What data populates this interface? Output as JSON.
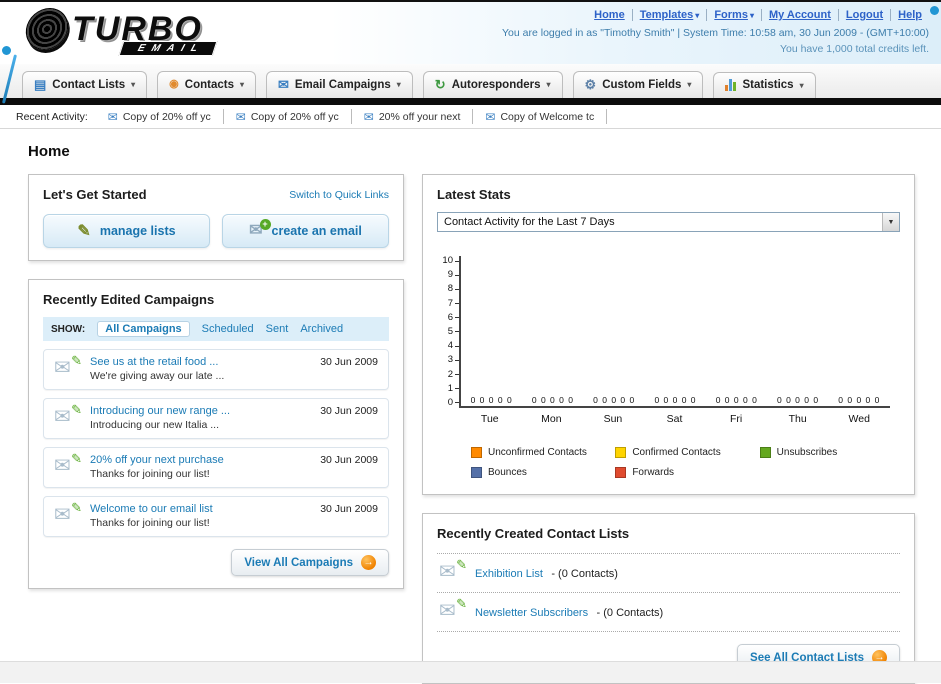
{
  "brand": {
    "name": "TURBO",
    "sub": "EMAIL"
  },
  "icons": {
    "chevron_down": "▾",
    "select_arrow": "▼",
    "envelope": "✉",
    "pencil": "✎",
    "arrow_right": "→",
    "plus": "+",
    "person": "◉",
    "list": "▤",
    "refresh": "↻",
    "gear": "⚙"
  },
  "colors": {
    "link_blue": "#1b7bb5",
    "top_link_blue": "#2d62c8",
    "nav_bar_black": "#0c0c0c",
    "orange_accent": "#f08200"
  },
  "top_nav": {
    "links": [
      "Home",
      "Templates",
      "Forms",
      "My Account",
      "Logout",
      "Help"
    ],
    "login_info": "You are logged in as \"Timothy Smith\" | System Time: 10:58 am, 30 Jun 2009 - (GMT+10:00)",
    "credits_info": "You have 1,000 total credits left."
  },
  "main_nav": {
    "items": [
      "Contact Lists",
      "Contacts",
      "Email Campaigns",
      "Autoresponders",
      "Custom Fields",
      "Statistics"
    ]
  },
  "recent_activity": {
    "label": "Recent Activity:",
    "items": [
      "Copy of 20% off yc",
      "Copy of 20% off yc",
      "20% off your next",
      "Copy of Welcome tc"
    ]
  },
  "page": {
    "title": "Home"
  },
  "get_started": {
    "title": "Let's Get Started",
    "switch_link": "Switch to Quick Links",
    "buttons": [
      {
        "label": "manage lists"
      },
      {
        "label": "create an email"
      }
    ]
  },
  "campaigns": {
    "title": "Recently Edited Campaigns",
    "show_label": "SHOW:",
    "tabs": [
      "All Campaigns",
      "Scheduled",
      "Sent",
      "Archived"
    ],
    "selected_tab": "All Campaigns",
    "items": [
      {
        "title": "See us at the retail food ...",
        "subtitle": "We're giving away our late ...",
        "date": "30 Jun 2009"
      },
      {
        "title": "Introducing our new range ...",
        "subtitle": "Introducing our new Italia ...",
        "date": "30 Jun 2009"
      },
      {
        "title": "20% off your next purchase",
        "subtitle": "Thanks for joining our list!",
        "date": "30 Jun 2009"
      },
      {
        "title": "Welcome to our email list",
        "subtitle": "Thanks for joining our list!",
        "date": "30 Jun 2009"
      }
    ],
    "view_all_label": "View All Campaigns"
  },
  "latest_stats": {
    "title": "Latest Stats",
    "period_selector": "Contact Activity for the Last 7 Days"
  },
  "chart_data": {
    "type": "bar",
    "title": "Contact Activity for the Last 7 Days",
    "categories": [
      "Tue",
      "Mon",
      "Sun",
      "Sat",
      "Fri",
      "Thu",
      "Wed"
    ],
    "series": [
      {
        "name": "Unconfirmed Contacts",
        "color": "#ff8a00",
        "values": [
          0,
          0,
          0,
          0,
          0,
          0,
          0
        ]
      },
      {
        "name": "Confirmed Contacts",
        "color": "#ffd400",
        "values": [
          0,
          0,
          0,
          0,
          0,
          0,
          0
        ]
      },
      {
        "name": "Unsubscribes",
        "color": "#64a81f",
        "values": [
          0,
          0,
          0,
          0,
          0,
          0,
          0
        ]
      },
      {
        "name": "Bounces",
        "color": "#5470a8",
        "values": [
          0,
          0,
          0,
          0,
          0,
          0,
          0
        ]
      },
      {
        "name": "Forwards",
        "color": "#e04b2f",
        "values": [
          0,
          0,
          0,
          0,
          0,
          0,
          0
        ]
      }
    ],
    "ylim": [
      0,
      10
    ],
    "yticks": [
      10,
      9,
      8,
      7,
      6,
      5,
      4,
      3,
      2,
      1,
      0
    ],
    "zero_row": "0 0 0 0 0",
    "grid": false,
    "legend_position": "bottom"
  },
  "contact_lists": {
    "title": "Recently Created Contact Lists",
    "items": [
      {
        "name": "Exhibition List",
        "detail": "- (0 Contacts)"
      },
      {
        "name": "Newsletter Subscribers",
        "detail": "- (0 Contacts)"
      }
    ],
    "see_all_label": "See All Contact Lists"
  }
}
